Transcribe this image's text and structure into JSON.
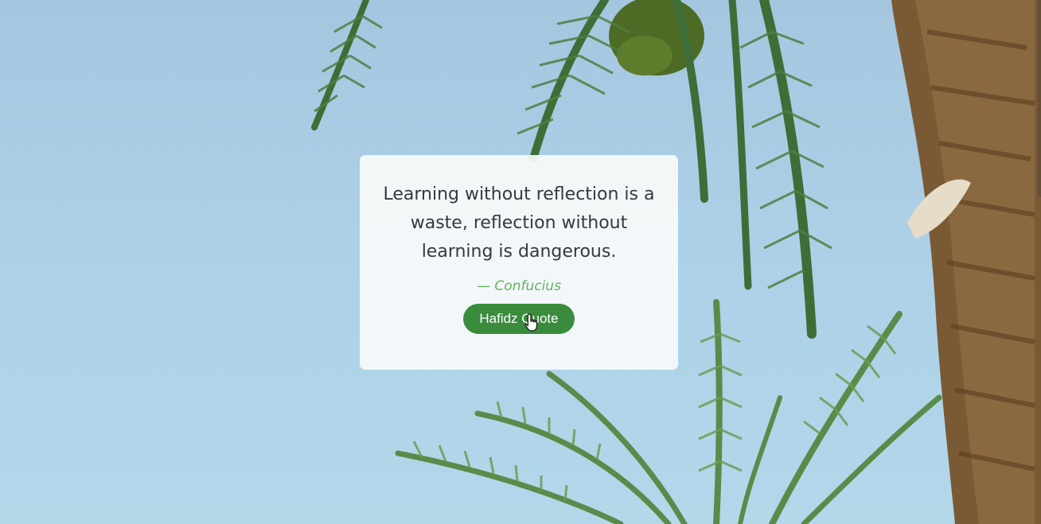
{
  "quote": {
    "text": "Learning without reflection is a waste, reflection without learning is dangerous.",
    "author": "— Confucius",
    "button_label": "Hafidz Quote"
  },
  "colors": {
    "sky": "#a9c8df",
    "card": "#f8fafa",
    "author": "#63b25d",
    "button": "#3a8b3c",
    "text": "#333a3f"
  },
  "background": {
    "icon": "palm-tree-photo"
  }
}
